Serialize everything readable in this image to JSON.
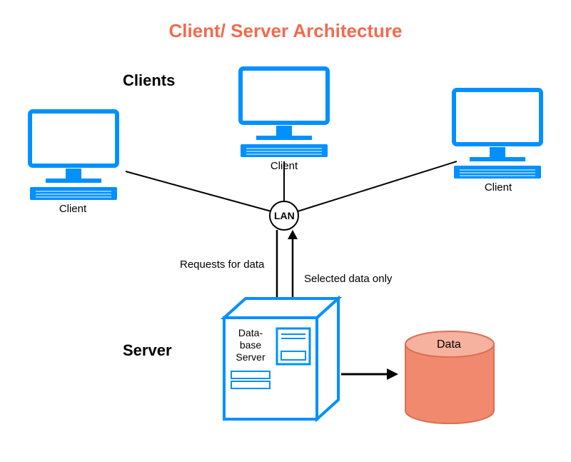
{
  "title": "Client/ Server Architecture",
  "sections": {
    "clients": "Clients",
    "server": "Server"
  },
  "nodes": {
    "client_left": "Client",
    "client_mid": "Client",
    "client_right": "Client",
    "lan": "LAN",
    "db_server": "Data-\nbase\nServer",
    "data": "Data"
  },
  "edges": {
    "request": "Requests for data",
    "response": "Selected data only"
  },
  "colors": {
    "accent": "#0090ff",
    "title": "#f26b4f",
    "data_fill": "#f1896f",
    "data_stroke": "#d87056"
  }
}
